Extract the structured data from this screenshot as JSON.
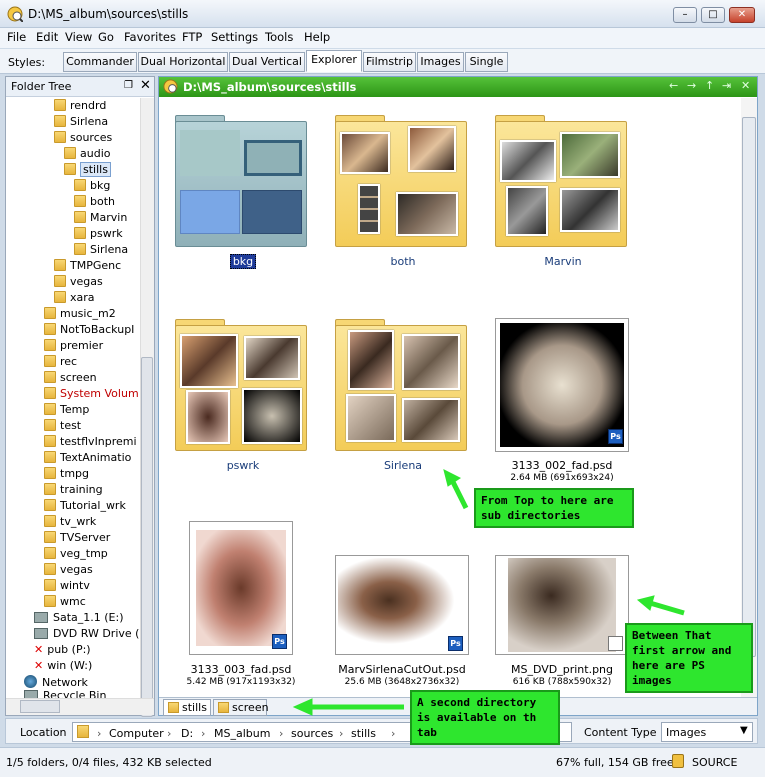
{
  "window": {
    "title": "D:\\MS_album\\sources\\stills",
    "min_glyph": "–",
    "max_glyph": "□",
    "close_glyph": "✕"
  },
  "menu": [
    "File",
    "Edit",
    "View",
    "Go",
    "Favorites",
    "FTP",
    "Settings",
    "Tools",
    "Help"
  ],
  "styles_bar": {
    "label": "Styles:",
    "tabs": [
      "Commander",
      "Dual Horizontal",
      "Dual Vertical",
      "Explorer",
      "Filmstrip",
      "Images",
      "Single"
    ],
    "active": "Explorer"
  },
  "folder_tree": {
    "title": "Folder Tree",
    "pin_glyph": "❐",
    "close_glyph": "✕",
    "items": [
      "rendrd",
      "Sirlena",
      "sources",
      "audio",
      "stills",
      "bkg",
      "both",
      "Marvin",
      "pswrk",
      "Sirlena",
      "TMPGenc",
      "vegas",
      "xara",
      "music_m2",
      "NotToBackupI",
      "premier",
      "rec",
      "screen",
      "System Volum",
      "Temp",
      "test",
      "testflvInpremi",
      "TextAnimatio",
      "tmpg",
      "training",
      "Tutorial_wrk",
      "tv_wrk",
      "TVServer",
      "veg_tmp",
      "vegas",
      "wintv",
      "wmc",
      "Sata_1.1 (E:)",
      "DVD RW Drive (I",
      "pub (P:)",
      "win (W:)",
      "Network",
      "Recycle Bin"
    ],
    "selected": "stills"
  },
  "main": {
    "path": "D:\\MS_album\\sources\\stills",
    "nav_glyphs": [
      "←",
      "→",
      "↑",
      "⇥",
      "✕"
    ],
    "folders": [
      "bkg",
      "both",
      "Marvin",
      "pswrk",
      "Sirlena"
    ],
    "files": [
      {
        "name": "3133_002_fad.psd",
        "meta": "2.64 MB (691x693x24)",
        "badge": "Ps"
      },
      {
        "name": "3133_003_fad.psd",
        "meta": "5.42 MB (917x1193x32)",
        "badge": "Ps"
      },
      {
        "name": "MarvSirlenaCutOut.psd",
        "meta": "25.6 MB (3648x2736x32)",
        "badge": "Ps"
      },
      {
        "name": "MS_DVD_print.png",
        "meta": "616 KB (788x590x32)",
        "badge": ""
      }
    ],
    "tabs": [
      "stills",
      "screen"
    ]
  },
  "location": {
    "label": "Location",
    "crumbs": [
      "Computer",
      "D:",
      "MS_album",
      "sources",
      "stills"
    ],
    "content_type_label": "Content Type",
    "content_type_value": "Images"
  },
  "status": {
    "left": "1/5 folders, 0/4 files, 432 KB selected",
    "mid": "67% full, 154 GB free",
    "right": "SOURCE"
  },
  "callouts": [
    "From Top to here are sub directories",
    "Between That first arrow and here are PS images",
    "A second directory is available on th tab"
  ]
}
